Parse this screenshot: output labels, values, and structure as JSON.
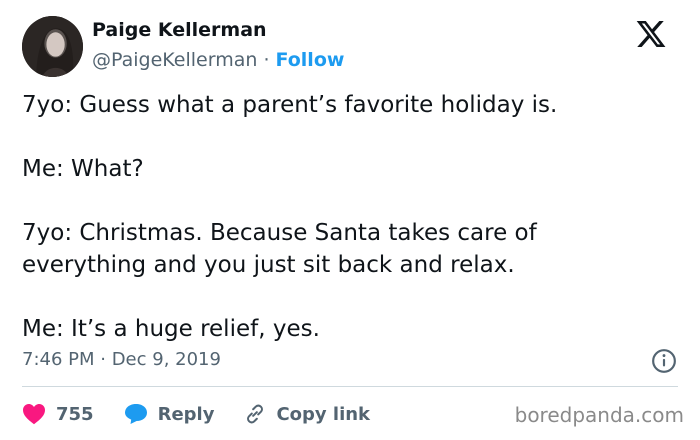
{
  "author": {
    "name": "Paige Kellerman",
    "handle": "@PaigeKellerman",
    "separator": " · ",
    "follow_label": "Follow"
  },
  "icons": {
    "avatar": "profile-photo",
    "brand": "x-logo-icon",
    "info": "info-icon",
    "like": "heart-icon",
    "reply": "speech-bubble-icon",
    "copy": "link-icon"
  },
  "tweet": {
    "paragraphs": [
      "7yo: Guess what a parent’s favorite holiday is.",
      "Me: What?",
      "7yo: Christmas. Because Santa takes care of everything and you just sit back and relax.",
      "Me: It’s a huge relief, yes."
    ],
    "timestamp": "7:46 PM · Dec 9, 2019"
  },
  "actions": {
    "like_count": "755",
    "reply_label": "Reply",
    "copy_label": "Copy link"
  },
  "watermark": "boredpanda.com",
  "colors": {
    "accent": "#1d9bf0",
    "like": "#f91880",
    "secondary_text": "#536471",
    "primary_text": "#0f1419"
  }
}
